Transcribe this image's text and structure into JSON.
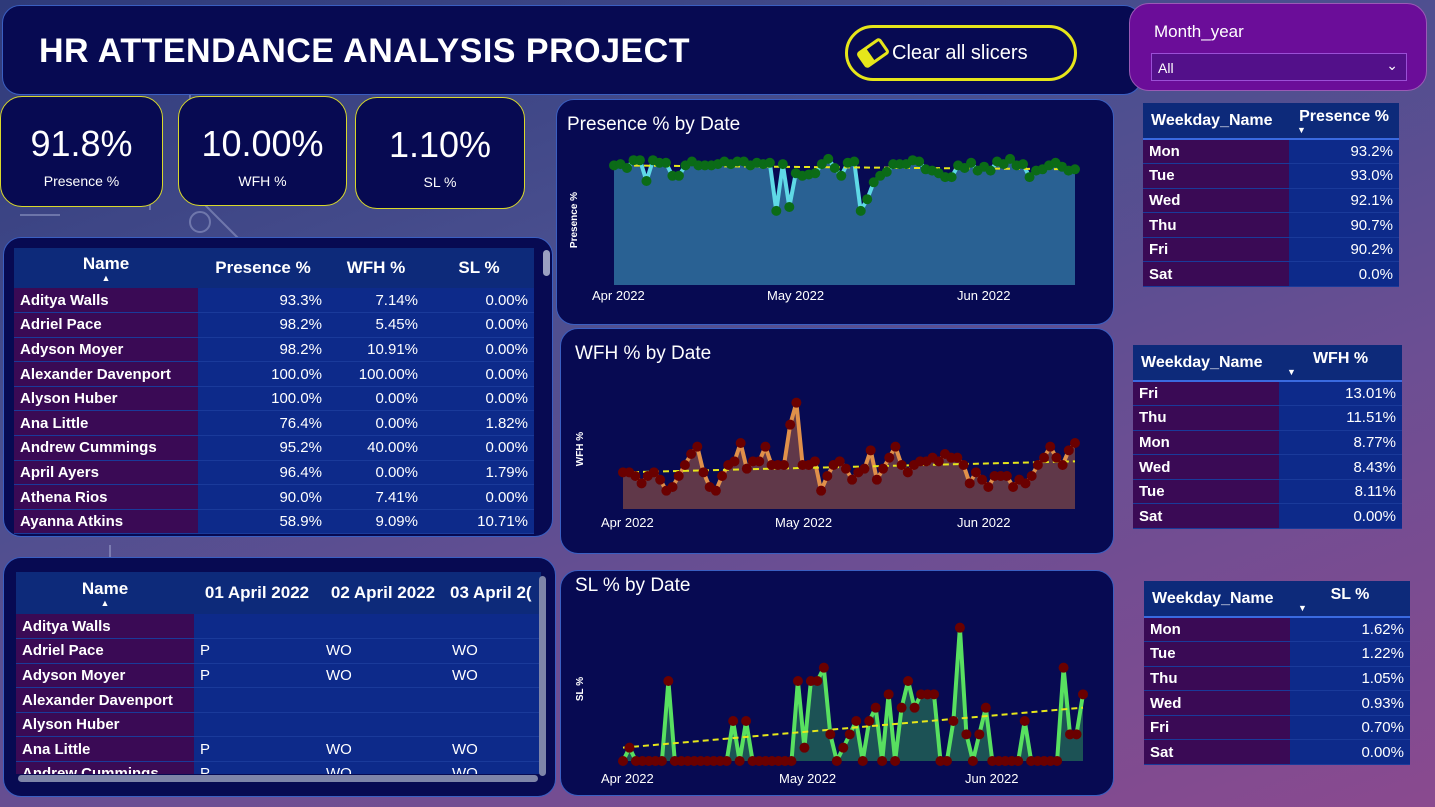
{
  "header": {
    "title": "HR ATTENDANCE ANALYSIS PROJECT",
    "clear_label": "Clear all slicers"
  },
  "slicer": {
    "label": "Month_year",
    "value": "All"
  },
  "kpis": [
    {
      "value": "91.8%",
      "label": "Presence %"
    },
    {
      "value": "10.00%",
      "label": "WFH %"
    },
    {
      "value": "1.10%",
      "label": "SL %"
    }
  ],
  "summary_table": {
    "headers": [
      "Name",
      "Presence %",
      "WFH %",
      "SL %"
    ],
    "rows": [
      [
        "Aditya Walls",
        "93.3%",
        "7.14%",
        "0.00%"
      ],
      [
        "Adriel Pace",
        "98.2%",
        "5.45%",
        "0.00%"
      ],
      [
        "Adyson Moyer",
        "98.2%",
        "10.91%",
        "0.00%"
      ],
      [
        "Alexander Davenport",
        "100.0%",
        "100.00%",
        "0.00%"
      ],
      [
        "Alyson Huber",
        "100.0%",
        "0.00%",
        "0.00%"
      ],
      [
        "Ana Little",
        "76.4%",
        "0.00%",
        "1.82%"
      ],
      [
        "Andrew Cummings",
        "95.2%",
        "40.00%",
        "0.00%"
      ],
      [
        "April Ayers",
        "96.4%",
        "0.00%",
        "1.79%"
      ],
      [
        "Athena Rios",
        "90.0%",
        "7.41%",
        "0.00%"
      ],
      [
        "Ayanna Atkins",
        "58.9%",
        "9.09%",
        "10.71%"
      ]
    ]
  },
  "daily_table": {
    "headers": [
      "Name",
      "01 April 2022",
      "02 April 2022",
      "03 April 2("
    ],
    "rows": [
      [
        "Aditya Walls",
        "",
        "",
        ""
      ],
      [
        "Adriel Pace",
        "P",
        "WO",
        "WO"
      ],
      [
        "Adyson Moyer",
        "P",
        "WO",
        "WO"
      ],
      [
        "Alexander Davenport",
        "",
        "",
        ""
      ],
      [
        "Alyson Huber",
        "",
        "",
        ""
      ],
      [
        "Ana Little",
        "P",
        "WO",
        "WO"
      ],
      [
        "Andrew Cummings",
        "P",
        "WO",
        "WO"
      ]
    ]
  },
  "weekday_presence": {
    "headers": [
      "Weekday_Name",
      "Presence %"
    ],
    "rows": [
      [
        "Mon",
        "93.2%"
      ],
      [
        "Tue",
        "93.0%"
      ],
      [
        "Wed",
        "92.1%"
      ],
      [
        "Thu",
        "90.7%"
      ],
      [
        "Fri",
        "90.2%"
      ],
      [
        "Sat",
        "0.0%"
      ]
    ]
  },
  "weekday_wfh": {
    "headers": [
      "Weekday_Name",
      "WFH %"
    ],
    "rows": [
      [
        "Fri",
        "13.01%"
      ],
      [
        "Thu",
        "11.51%"
      ],
      [
        "Mon",
        "8.77%"
      ],
      [
        "Wed",
        "8.43%"
      ],
      [
        "Tue",
        "8.11%"
      ],
      [
        "Sat",
        "0.00%"
      ]
    ]
  },
  "weekday_sl": {
    "headers": [
      "Weekday_Name",
      "SL %"
    ],
    "rows": [
      [
        "Mon",
        "1.62%"
      ],
      [
        "Tue",
        "1.22%"
      ],
      [
        "Thu",
        "1.05%"
      ],
      [
        "Wed",
        "0.93%"
      ],
      [
        "Fri",
        "0.70%"
      ],
      [
        "Sat",
        "0.00%"
      ]
    ]
  },
  "chart_data": [
    {
      "type": "area",
      "title": "Presence % by Date",
      "ylabel": "Presence %",
      "xticks": [
        "Apr 2022",
        "May 2022",
        "Jun 2022"
      ],
      "colors": {
        "line": "#5fd9e6",
        "fill": "#2d6a9a",
        "marker": "#0b6b17",
        "trend": "#e6e61a"
      },
      "values": [
        0.92,
        0.93,
        0.9,
        0.96,
        0.96,
        0.8,
        0.96,
        0.94,
        0.94,
        0.84,
        0.84,
        0.92,
        0.95,
        0.92,
        0.92,
        0.92,
        0.93,
        0.95,
        0.93,
        0.95,
        0.95,
        0.92,
        0.94,
        0.93,
        0.94,
        0.57,
        0.93,
        0.6,
        0.86,
        0.84,
        0.85,
        0.86,
        0.93,
        0.97,
        0.9,
        0.84,
        0.94,
        0.95,
        0.57,
        0.66,
        0.79,
        0.84,
        0.87,
        0.93,
        0.93,
        0.93,
        0.96,
        0.95,
        0.89,
        0.88,
        0.86,
        0.83,
        0.83,
        0.92,
        0.9,
        0.94,
        0.88,
        0.91,
        0.88,
        0.95,
        0.93,
        0.97,
        0.92,
        0.93,
        0.83,
        0.88,
        0.89,
        0.92,
        0.94,
        0.91,
        0.88,
        0.89
      ],
      "trend": [
        0.92,
        0.89
      ]
    },
    {
      "type": "area",
      "title": "WFH % by Date",
      "ylabel": "WFH %",
      "xticks": [
        "Apr 2022",
        "May 2022",
        "Jun 2022"
      ],
      "colors": {
        "line": "#e0904a",
        "fill": "#6a3d48",
        "marker": "#6a0000",
        "trend": "#e6e61a"
      },
      "values": [
        0.1,
        0.1,
        0.09,
        0.07,
        0.09,
        0.1,
        0.08,
        0.05,
        0.06,
        0.09,
        0.12,
        0.15,
        0.17,
        0.1,
        0.06,
        0.05,
        0.09,
        0.12,
        0.13,
        0.18,
        0.11,
        0.13,
        0.13,
        0.17,
        0.12,
        0.12,
        0.12,
        0.23,
        0.29,
        0.12,
        0.12,
        0.13,
        0.05,
        0.09,
        0.12,
        0.13,
        0.11,
        0.08,
        0.1,
        0.11,
        0.16,
        0.08,
        0.11,
        0.14,
        0.17,
        0.12,
        0.1,
        0.12,
        0.13,
        0.13,
        0.14,
        0.13,
        0.15,
        0.14,
        0.14,
        0.12,
        0.07,
        0.1,
        0.08,
        0.06,
        0.09,
        0.09,
        0.09,
        0.06,
        0.08,
        0.07,
        0.09,
        0.12,
        0.14,
        0.17,
        0.14,
        0.12,
        0.16,
        0.18
      ],
      "trend": [
        0.1,
        0.13
      ]
    },
    {
      "type": "area",
      "title": "SL % by Date",
      "ylabel": "SL %",
      "xticks": [
        "Apr 2022",
        "May 2022",
        "Jun 2022"
      ],
      "colors": {
        "line": "#58e060",
        "fill": "#1f5a55",
        "marker": "#6a0000",
        "trend": "#e6e61a"
      },
      "values": [
        0.0,
        0.01,
        0.0,
        0.0,
        0.0,
        0.0,
        0.0,
        0.06,
        0.0,
        0.0,
        0.0,
        0.0,
        0.0,
        0.0,
        0.0,
        0.0,
        0.0,
        0.03,
        0.0,
        0.03,
        0.0,
        0.0,
        0.0,
        0.0,
        0.0,
        0.0,
        0.0,
        0.06,
        0.01,
        0.06,
        0.06,
        0.07,
        0.02,
        0.0,
        0.01,
        0.02,
        0.03,
        0.0,
        0.03,
        0.04,
        0.0,
        0.05,
        0.0,
        0.04,
        0.06,
        0.04,
        0.05,
        0.05,
        0.05,
        0.0,
        0.0,
        0.03,
        0.1,
        0.02,
        0.0,
        0.02,
        0.04,
        0.0,
        0.0,
        0.0,
        0.0,
        0.0,
        0.03,
        0.0,
        0.0,
        0.0,
        0.0,
        0.0,
        0.07,
        0.02,
        0.02,
        0.05
      ],
      "trend": [
        0.01,
        0.04
      ]
    }
  ]
}
